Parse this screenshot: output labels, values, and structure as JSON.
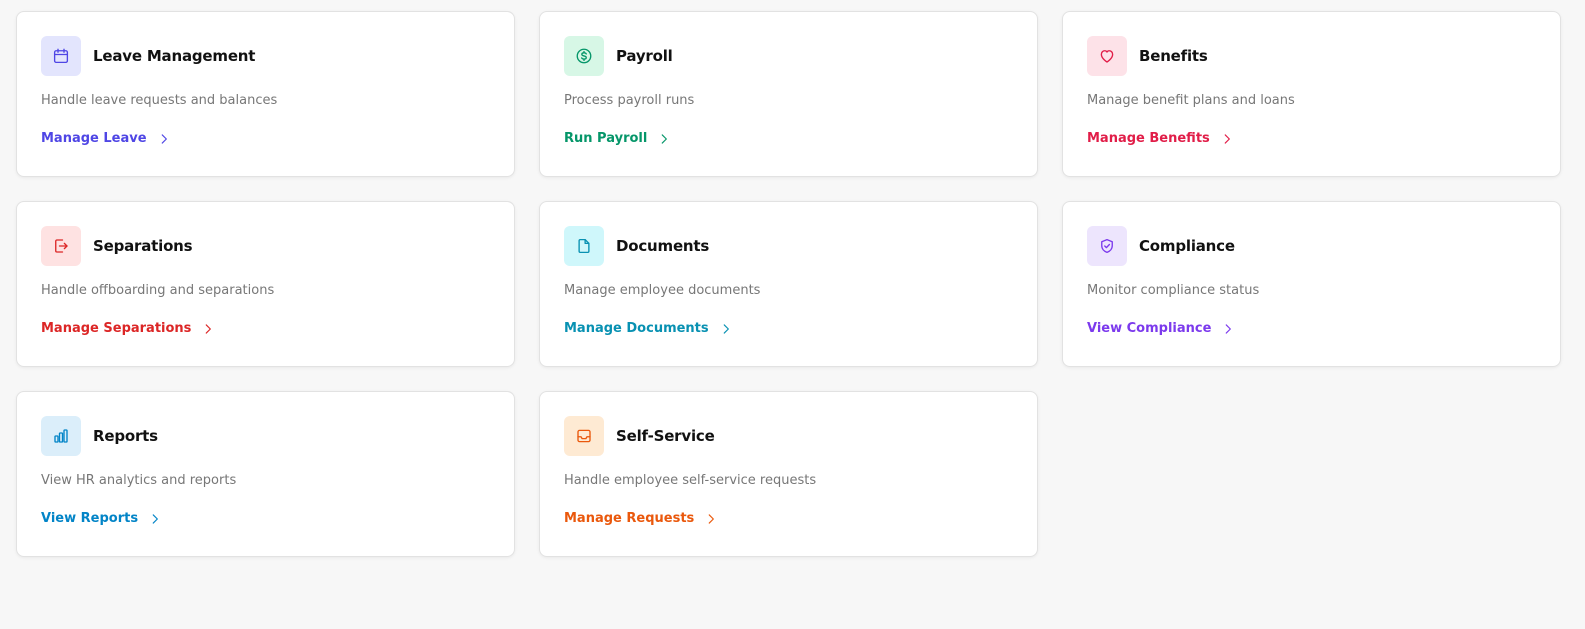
{
  "cards": [
    {
      "title": "Leave Management",
      "description": "Handle leave requests and balances",
      "link_label": "Manage Leave",
      "icon": "calendar-icon",
      "accent": "#4f46e5"
    },
    {
      "title": "Payroll",
      "description": "Process payroll runs",
      "link_label": "Run Payroll",
      "icon": "dollar-circle-icon",
      "accent": "#059669"
    },
    {
      "title": "Benefits",
      "description": "Manage benefit plans and loans",
      "link_label": "Manage Benefits",
      "icon": "heart-icon",
      "accent": "#e11d48"
    },
    {
      "title": "Separations",
      "description": "Handle offboarding and separations",
      "link_label": "Manage Separations",
      "icon": "logout-icon",
      "accent": "#dc2626"
    },
    {
      "title": "Documents",
      "description": "Manage employee documents",
      "link_label": "Manage Documents",
      "icon": "file-icon",
      "accent": "#0891b2"
    },
    {
      "title": "Compliance",
      "description": "Monitor compliance status",
      "link_label": "View Compliance",
      "icon": "shield-check-icon",
      "accent": "#7c3aed"
    },
    {
      "title": "Reports",
      "description": "View HR analytics and reports",
      "link_label": "View Reports",
      "icon": "bar-chart-icon",
      "accent": "#0284c7"
    },
    {
      "title": "Self-Service",
      "description": "Handle employee self-service requests",
      "link_label": "Manage Requests",
      "icon": "inbox-icon",
      "accent": "#ea580c"
    }
  ]
}
